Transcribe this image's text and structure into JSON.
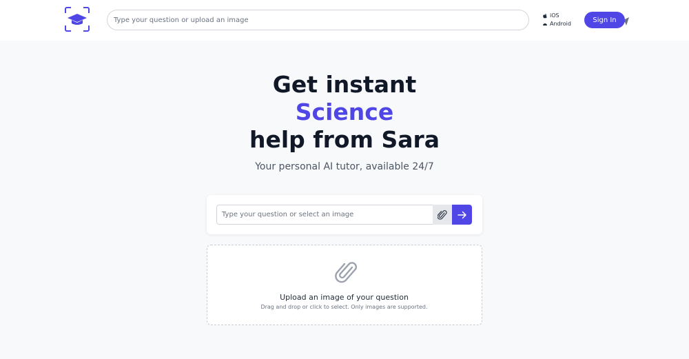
{
  "header": {
    "search_placeholder": "Type your question or upload an image",
    "apps": {
      "ios_label": "iOS",
      "android_label": "Android"
    },
    "signin_label": "Sign In"
  },
  "hero": {
    "line1": "Get instant",
    "subject": "Science",
    "line3": "help from Sara",
    "subtitle": "Your personal AI tutor, available 24/7"
  },
  "question_card": {
    "placeholder": "Type your question or select an image"
  },
  "dropzone": {
    "title": "Upload an image of your question",
    "subtitle": "Drag and drop or click to select. Only images are supported."
  },
  "colors": {
    "accent": "#4f46e5",
    "text": "#111827",
    "background": "#f8f9fb"
  },
  "icons": [
    "logo-graduation-cap-icon",
    "upload-icon",
    "send-icon",
    "apple-icon",
    "android-icon",
    "paperclip-icon",
    "arrow-right-icon"
  ]
}
